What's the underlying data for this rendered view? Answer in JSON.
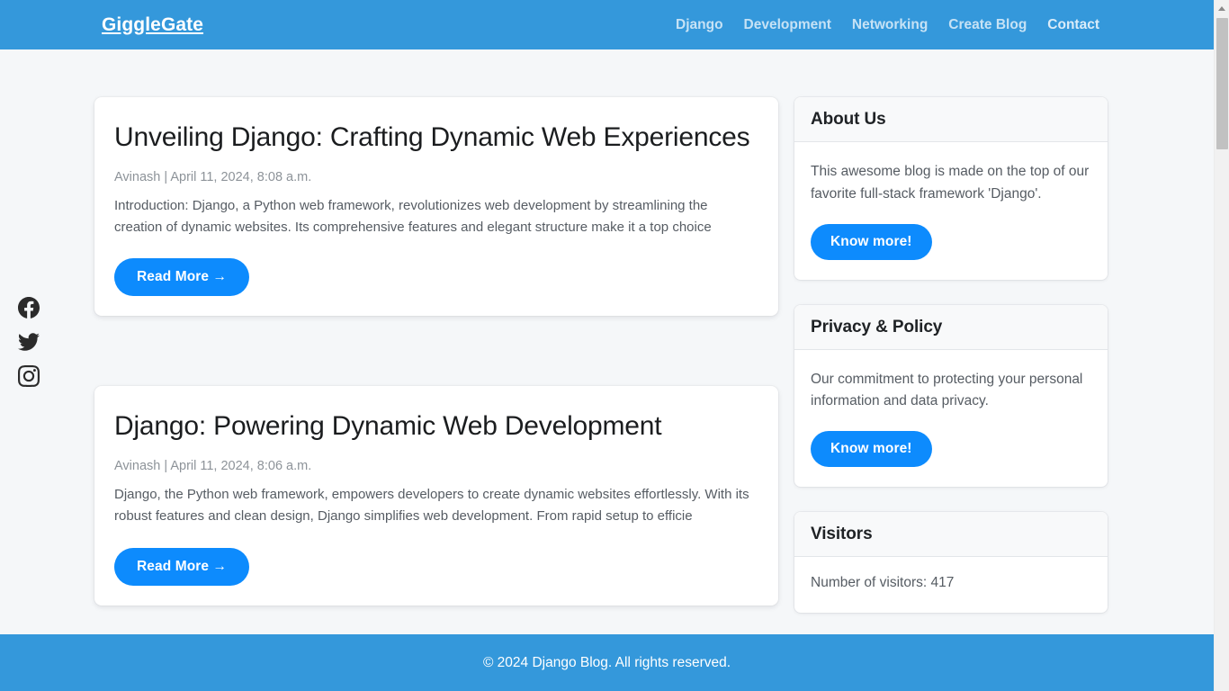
{
  "header": {
    "brand": "GiggleGate",
    "brand_color": "#ffffff",
    "background_color": "#3498db",
    "nav": [
      {
        "label": "Django"
      },
      {
        "label": "Development"
      },
      {
        "label": "Networking"
      },
      {
        "label": "Create Blog"
      },
      {
        "label": "Contact"
      }
    ]
  },
  "social": [
    {
      "name": "facebook-icon",
      "label": "Facebook"
    },
    {
      "name": "twitter-icon",
      "label": "Twitter"
    },
    {
      "name": "instagram-icon",
      "label": "Instagram"
    }
  ],
  "posts": [
    {
      "title": "Unveiling Django: Crafting Dynamic Web Experiences",
      "meta": "Avinash | April 11, 2024, 8:08 a.m.",
      "excerpt": "Introduction: Django, a Python web framework, revolutionizes web development by streamlining the creation of dynamic websites. Its comprehensive features and elegant structure make it a top choice",
      "read_more_label": "Read More →"
    },
    {
      "title": "Django: Powering Dynamic Web Development",
      "meta": "Avinash | April 11, 2024, 8:06 a.m.",
      "excerpt": "Django, the Python web framework, empowers developers to create dynamic websites effortlessly. With its robust features and clean design, Django simplifies web development. From rapid setup to efficie",
      "read_more_label": "Read More →"
    }
  ],
  "sidebar": {
    "widgets": [
      {
        "title": "About Us",
        "text": "This awesome blog is made on the top of our favorite full-stack framework 'Django'.",
        "button_label": "Know more!"
      },
      {
        "title": "Privacy & Policy",
        "text": "Our commitment to protecting your personal information and data privacy.",
        "button_label": "Know more!"
      },
      {
        "title": "Visitors",
        "text": "Number of visitors: 417"
      }
    ]
  },
  "footer": {
    "text": "© 2024 Django Blog. All rights reserved.",
    "background_color": "#3498db"
  },
  "theme": {
    "accent_button": "#0d8bfd",
    "page_background": "#f5f7f9",
    "card_background": "#ffffff"
  },
  "scrollbar": {
    "track_color": "#f1f1f1",
    "thumb_color": "#c1c1c1"
  }
}
